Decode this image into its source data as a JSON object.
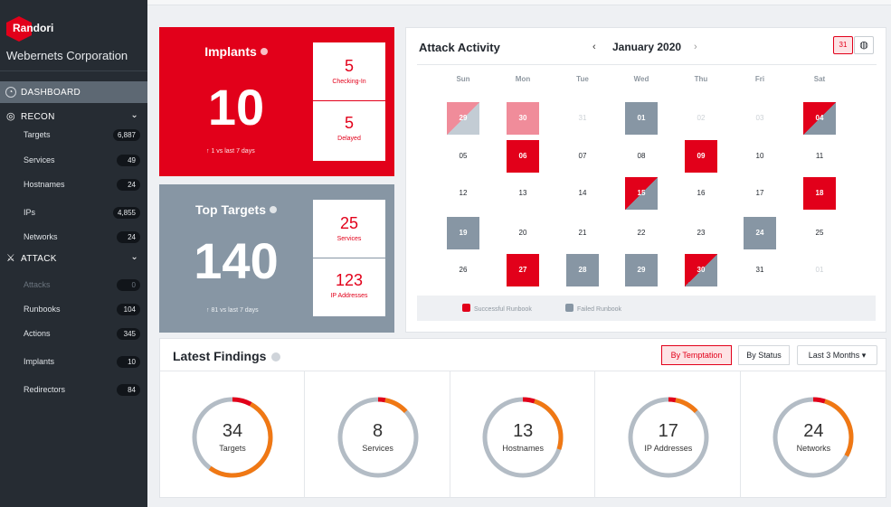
{
  "sidebar": {
    "logo_text": "Randori",
    "org_name": "Webernets Corporation",
    "dashboard_label": "DASHBOARD",
    "recon_label": "RECON",
    "attack_label": "ATTACK",
    "recon_items": [
      {
        "label": "Targets",
        "count": "6,887"
      },
      {
        "label": "Services",
        "count": "49"
      },
      {
        "label": "Hostnames",
        "count": "24"
      },
      {
        "label": "IPs",
        "count": "4,855"
      },
      {
        "label": "Networks",
        "count": "24"
      }
    ],
    "attack_items": [
      {
        "label": "Attacks",
        "count": "0"
      },
      {
        "label": "Runbooks",
        "count": "104"
      },
      {
        "label": "Actions",
        "count": "345"
      },
      {
        "label": "Implants",
        "count": "10"
      },
      {
        "label": "Redirectors",
        "count": "84"
      }
    ]
  },
  "implants": {
    "title": "Implants",
    "value": "10",
    "delta": "↑ 1 vs last 7 days",
    "checking_in": "5",
    "checking_in_label": "Checking-In",
    "delayed": "5",
    "delayed_label": "Delayed"
  },
  "top_targets": {
    "title": "Top Targets",
    "value": "140",
    "delta": "↑ 81 vs last 7 days",
    "services": "25",
    "services_label": "Services",
    "ip_addresses": "123",
    "ip_addresses_label": "IP Addresses"
  },
  "activity": {
    "title": "Attack Activity",
    "month": "January 2020",
    "prev": "‹",
    "next": "›",
    "cal_icon": "31",
    "weekdays": [
      "Sun",
      "Mon",
      "Tue",
      "Wed",
      "Thu",
      "Fri",
      "Sat"
    ],
    "weeks": [
      [
        {
          "d": "29",
          "s": "splitpale"
        },
        {
          "d": "30",
          "s": "pale"
        },
        {
          "d": "31",
          "s": "mute"
        },
        {
          "d": "01",
          "s": "fail"
        },
        {
          "d": "02",
          "s": "mute"
        },
        {
          "d": "03",
          "s": "mute"
        },
        {
          "d": "04",
          "s": "split"
        }
      ],
      [
        {
          "d": "05",
          "s": ""
        },
        {
          "d": "06",
          "s": "succ"
        },
        {
          "d": "07",
          "s": ""
        },
        {
          "d": "08",
          "s": ""
        },
        {
          "d": "09",
          "s": "succ"
        },
        {
          "d": "10",
          "s": ""
        },
        {
          "d": "11",
          "s": ""
        }
      ],
      [
        {
          "d": "12",
          "s": ""
        },
        {
          "d": "13",
          "s": ""
        },
        {
          "d": "14",
          "s": ""
        },
        {
          "d": "15",
          "s": "split"
        },
        {
          "d": "16",
          "s": ""
        },
        {
          "d": "17",
          "s": ""
        },
        {
          "d": "18",
          "s": "succ"
        }
      ],
      [
        {
          "d": "19",
          "s": "fail"
        },
        {
          "d": "20",
          "s": ""
        },
        {
          "d": "21",
          "s": ""
        },
        {
          "d": "22",
          "s": ""
        },
        {
          "d": "23",
          "s": ""
        },
        {
          "d": "24",
          "s": "fail"
        },
        {
          "d": "25",
          "s": ""
        }
      ],
      [
        {
          "d": "26",
          "s": ""
        },
        {
          "d": "27",
          "s": "succ"
        },
        {
          "d": "28",
          "s": "fail"
        },
        {
          "d": "29",
          "s": "fail"
        },
        {
          "d": "30",
          "s": "split"
        },
        {
          "d": "31",
          "s": ""
        },
        {
          "d": "01",
          "s": "mute"
        }
      ]
    ],
    "legend_success": "Successful Runbook",
    "legend_failed": "Failed Runbook"
  },
  "findings": {
    "title": "Latest Findings",
    "by_temptation": "By Temptation",
    "by_status": "By Status",
    "range": "Last 3 Months ▾",
    "donuts": [
      {
        "value": "34",
        "label": "Targets",
        "red": 0.08,
        "orange": 0.52
      },
      {
        "value": "8",
        "label": "Services",
        "red": 0.03,
        "orange": 0.1
      },
      {
        "value": "13",
        "label": "Hostnames",
        "red": 0.05,
        "orange": 0.25
      },
      {
        "value": "17",
        "label": "IP Addresses",
        "red": 0.03,
        "orange": 0.1
      },
      {
        "value": "24",
        "label": "Networks",
        "red": 0.05,
        "orange": 0.28
      }
    ]
  },
  "colors": {
    "red": "#e2001a",
    "orange": "#f07814",
    "gray": "#b3bcc5"
  }
}
